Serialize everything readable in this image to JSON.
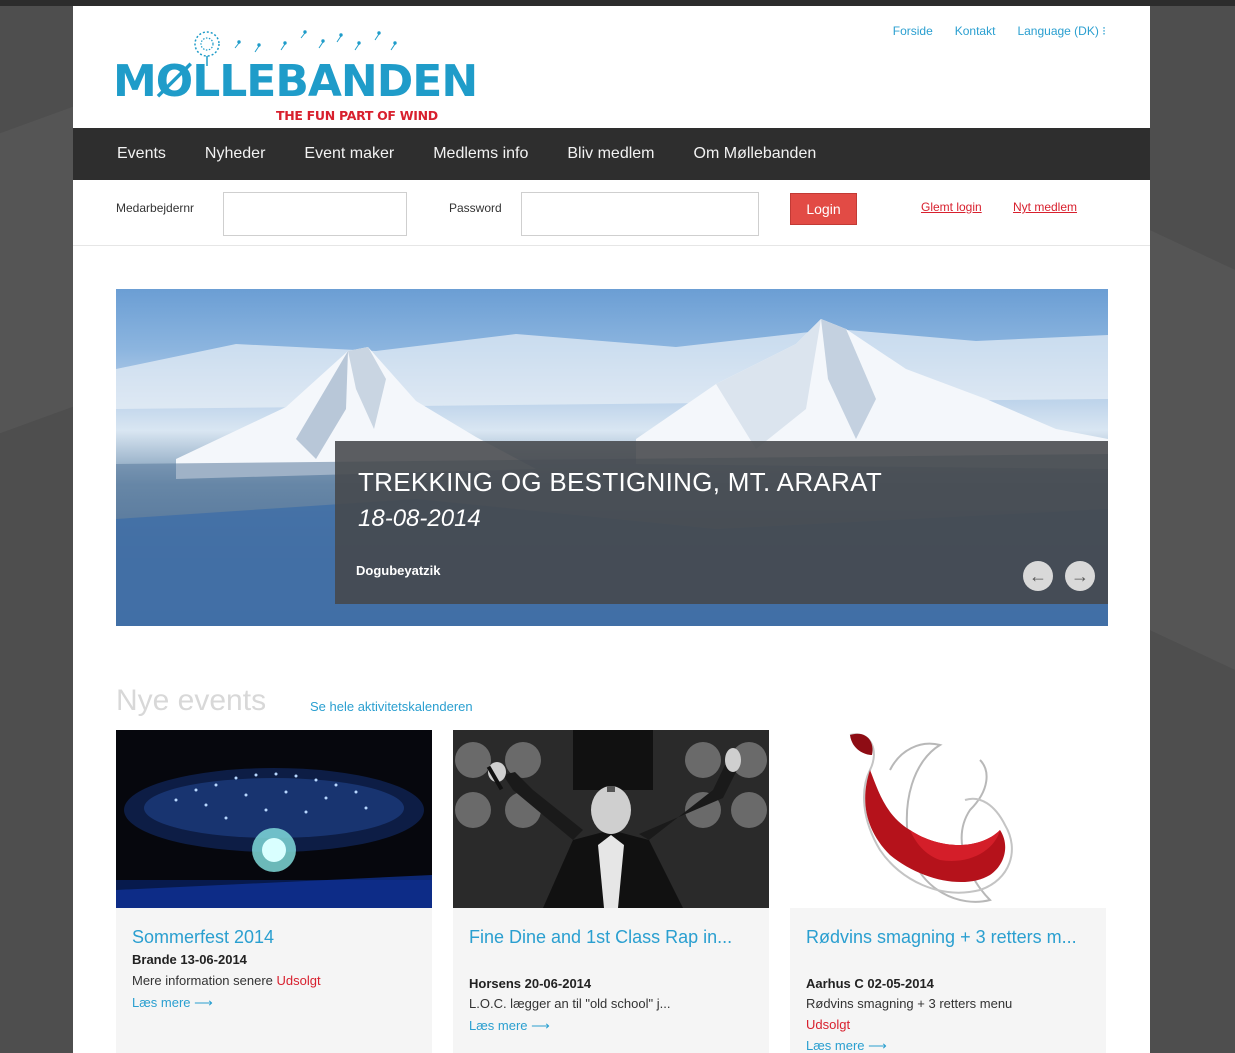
{
  "brand": {
    "name": "MØLLEBANDEN",
    "tagline": "THE FUN PART OF WIND"
  },
  "toplinks": [
    "Forside",
    "Kontakt",
    "Language (DK) ⁝"
  ],
  "nav": [
    "Events",
    "Nyheder",
    "Event maker",
    "Medlems info",
    "Bliv medlem",
    "Om Møllebanden"
  ],
  "login": {
    "user_label": "Medarbejdernr",
    "user_value": "",
    "password_label": "Password",
    "password_value": "",
    "button": "Login",
    "forgot": "Glemt login",
    "new_member": "Nyt medlem"
  },
  "hero": {
    "title": "TREKKING OG BESTIGNING, MT. ARARAT",
    "date": "18-08-2014",
    "location": "Dogubeyatzik",
    "prev_icon": "arrow-left-icon",
    "next_icon": "arrow-right-icon"
  },
  "events": {
    "heading": "Nye events",
    "calendar_link": "Se hele aktivitetskalenderen",
    "cards": [
      {
        "title": "Sommerfest 2014",
        "location": "Brande 13-06-2014",
        "description": "Mere information senere",
        "status": "Udsolgt",
        "more": "Læs mere"
      },
      {
        "title": "Fine Dine and 1st Class Rap in...",
        "location": "Horsens 20-06-2014",
        "description": "L.O.C. lægger an til \"old school\" j...",
        "status": "",
        "more": "Læs mere"
      },
      {
        "title": "Rødvins smagning + 3 retters m...",
        "location": "Aarhus C 02-05-2014",
        "description": "Rødvins smagning + 3 retters menu",
        "status": "Udsolgt",
        "more": "Læs mere"
      }
    ]
  },
  "colors": {
    "accent_blue": "#2a9fd0",
    "brand_red": "#d8202e",
    "nav_bg": "#2e2e2e",
    "login_button": "#e24b45"
  }
}
